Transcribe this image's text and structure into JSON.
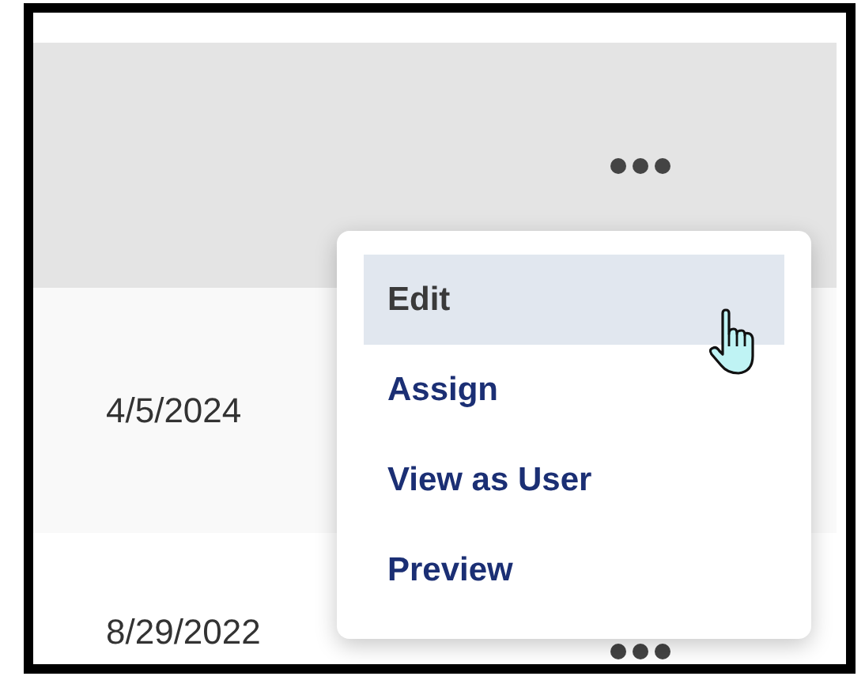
{
  "rows": [
    {
      "selected": true,
      "menu_open": true,
      "more_button": true
    },
    {
      "selected": false,
      "date": "4/5/2024",
      "more_button": false
    },
    {
      "selected": false,
      "date": "8/29/2022",
      "more_button": true
    }
  ],
  "menu": {
    "items": [
      {
        "label": "Edit",
        "selected": true
      },
      {
        "label": "Assign",
        "selected": false
      },
      {
        "label": "View as User",
        "selected": false
      },
      {
        "label": "Preview",
        "selected": false
      }
    ]
  }
}
